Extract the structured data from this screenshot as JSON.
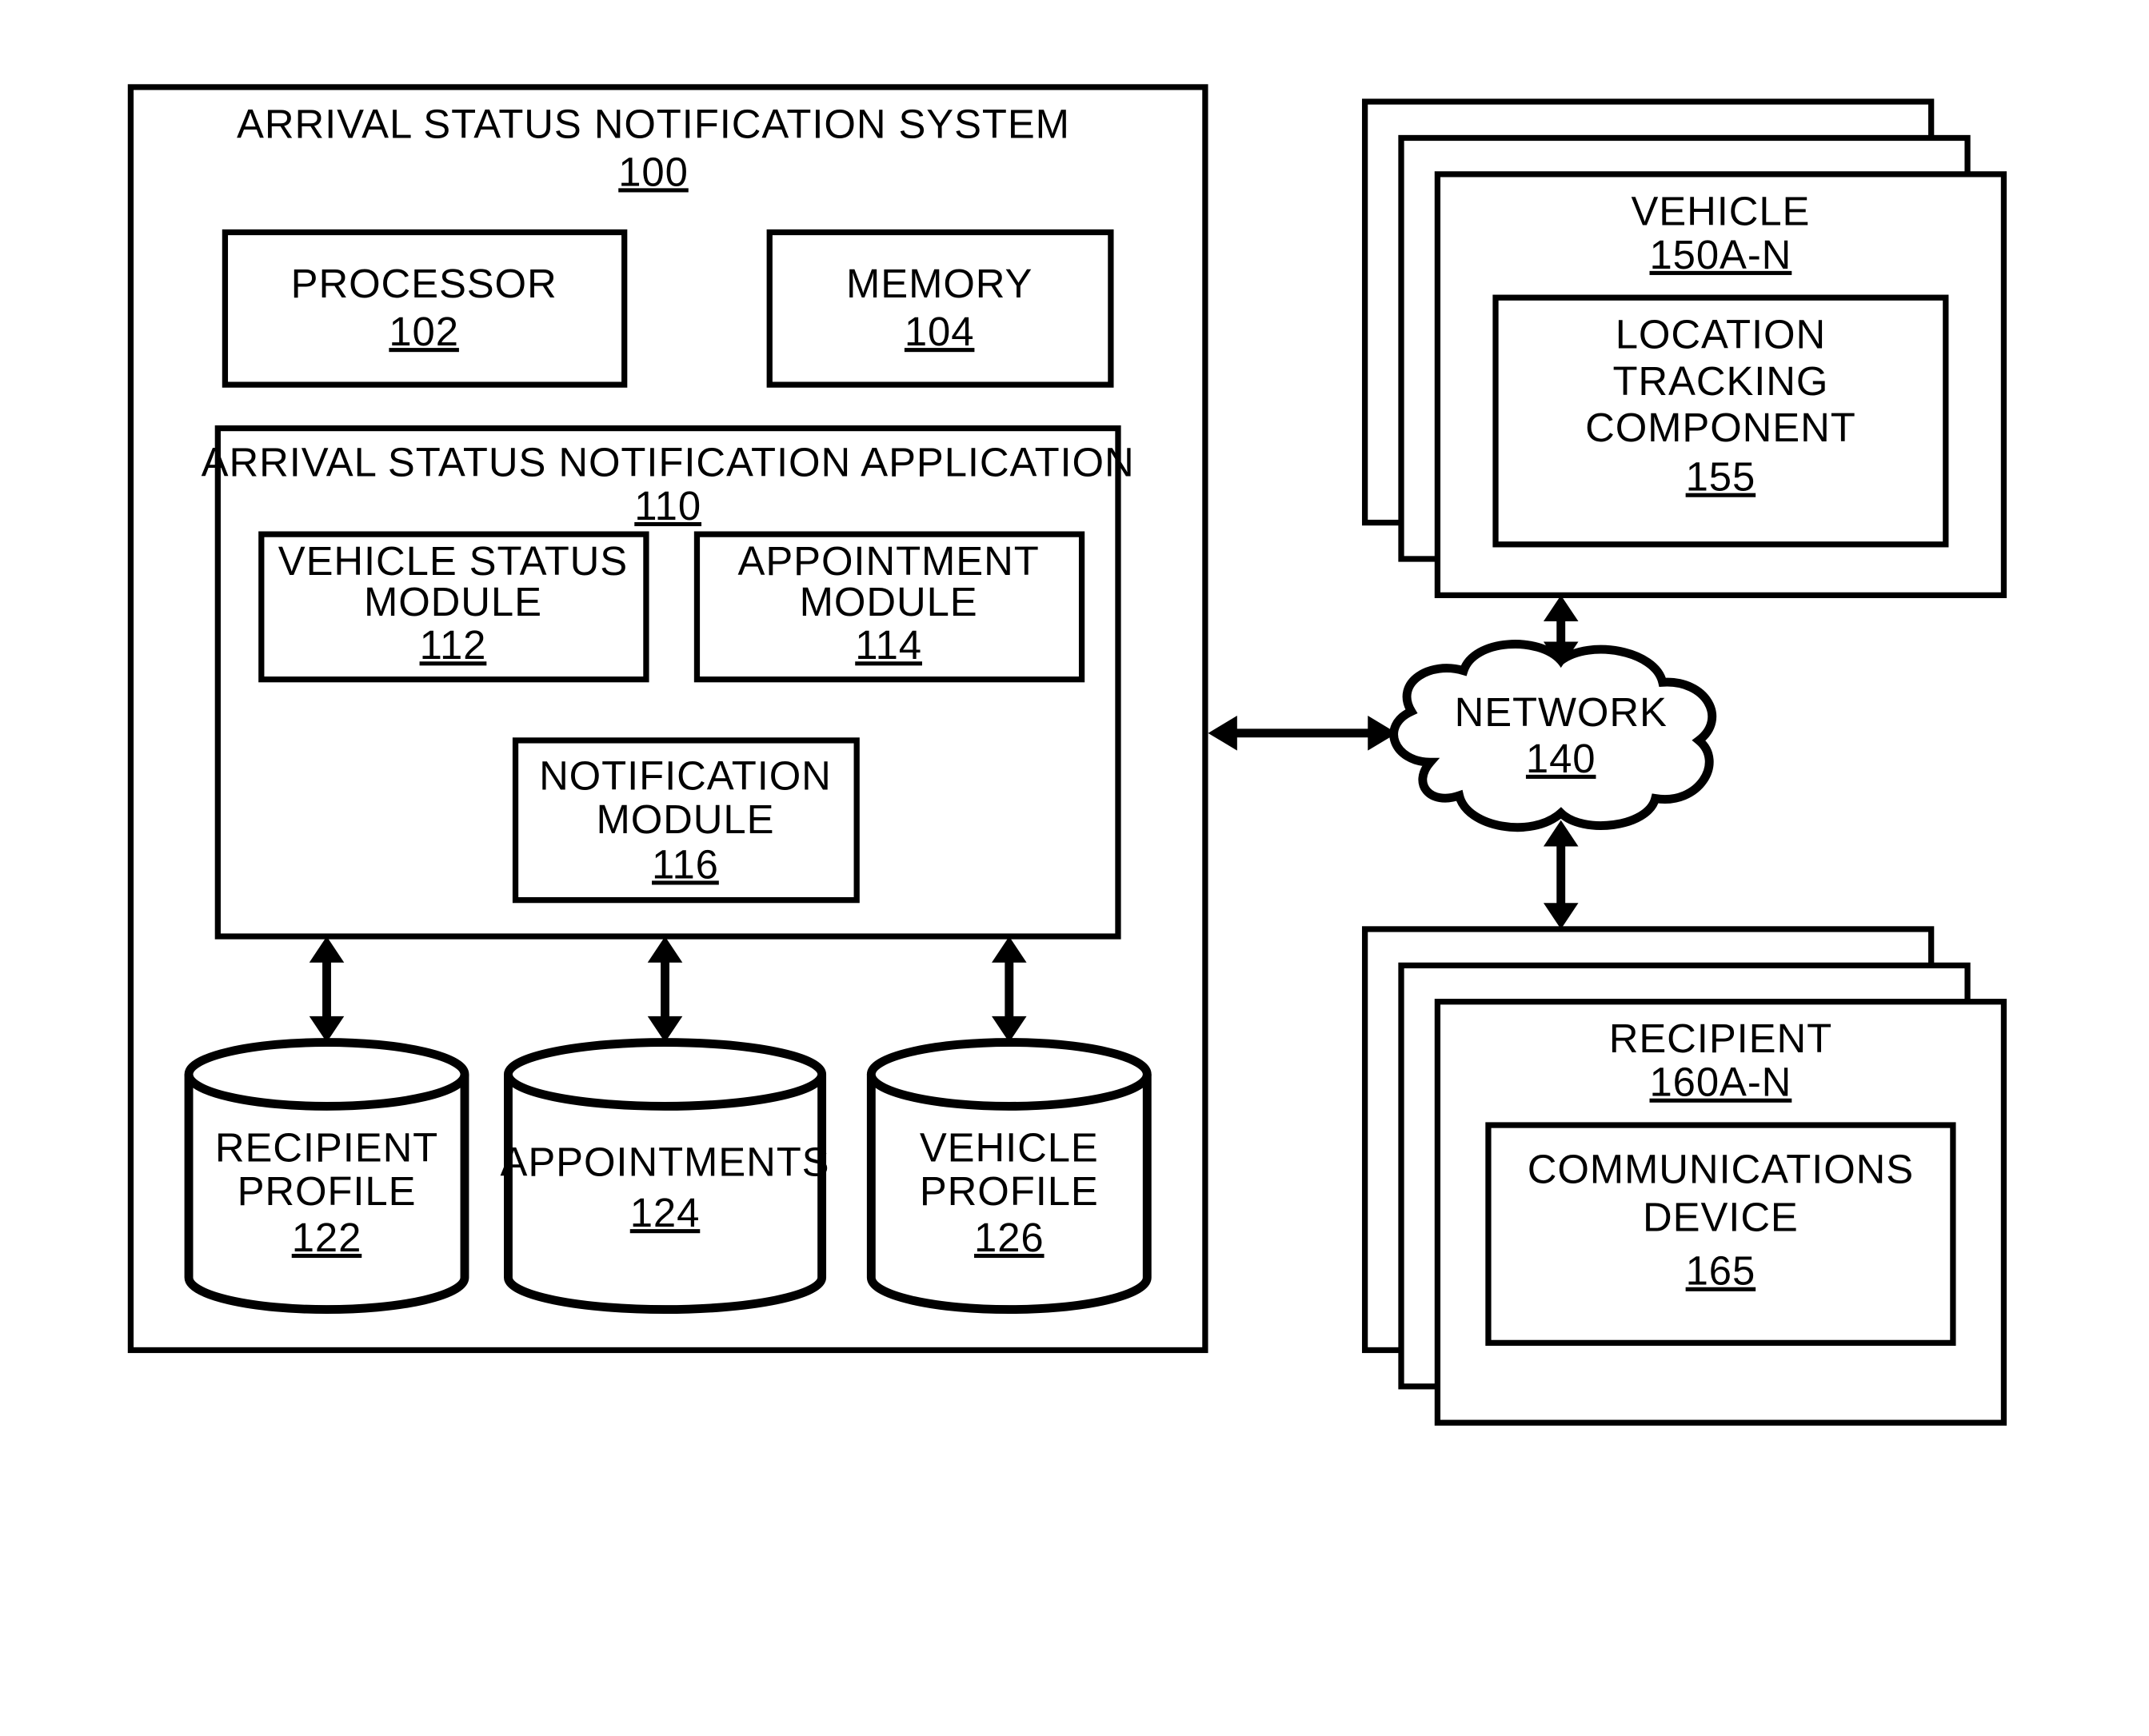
{
  "system": {
    "title": "ARRIVAL STATUS NOTIFICATION SYSTEM",
    "ref": "100",
    "processor": {
      "label": "PROCESSOR",
      "ref": "102"
    },
    "memory": {
      "label": "MEMORY",
      "ref": "104"
    },
    "application": {
      "title": "ARRIVAL STATUS NOTIFICATION APPLICATION",
      "ref": "110",
      "vehicle_status_module": {
        "line1": "VEHICLE STATUS",
        "line2": "MODULE",
        "ref": "112"
      },
      "appointment_module": {
        "line1": "APPOINTMENT",
        "line2": "MODULE",
        "ref": "114"
      },
      "notification_module": {
        "line1": "NOTIFICATION",
        "line2": "MODULE",
        "ref": "116"
      }
    },
    "stores": {
      "recipient_profile": {
        "line1": "RECIPIENT",
        "line2": "PROFILE",
        "ref": "122"
      },
      "appointments": {
        "line1": "APPOINTMENTS",
        "ref": "124"
      },
      "vehicle_profile": {
        "line1": "VEHICLE",
        "line2": "PROFILE",
        "ref": "126"
      }
    }
  },
  "network": {
    "label": "NETWORK",
    "ref": "140"
  },
  "vehicle": {
    "label": "VEHICLE",
    "ref": "150A-N",
    "component": {
      "line1": "LOCATION",
      "line2": "TRACKING",
      "line3": "COMPONENT",
      "ref": "155"
    }
  },
  "recipient": {
    "label": "RECIPIENT",
    "ref": "160A-N",
    "device": {
      "line1": "COMMUNICATIONS",
      "line2": "DEVICE",
      "ref": "165"
    }
  }
}
